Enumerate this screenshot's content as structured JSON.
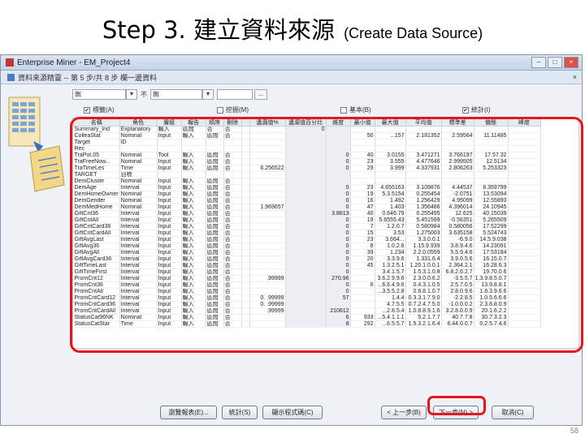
{
  "slide": {
    "title_main": "Step 3. 建立資料來源",
    "title_sub": "(Create Data Source)",
    "page_number": "58"
  },
  "window": {
    "title": "Enterprise Miner - EM_Project4",
    "dialog_title": "資料來源精靈 -- 第 5 步/共 8 步 欄一邊資料"
  },
  "filters": {
    "field1_value": "無",
    "label2": "不",
    "field2_value": "無",
    "field3_value": "",
    "browse_label": "..."
  },
  "checkboxes": [
    {
      "label": "標籤(A)",
      "checked": true
    },
    {
      "label": "挖掘(M)",
      "checked": false
    },
    {
      "label": "基本(B)",
      "checked": false
    },
    {
      "label": "統計(I)",
      "checked": true
    }
  ],
  "table": {
    "columns": [
      "名稱",
      "角色",
      "層級",
      "報告",
      "順序",
      "刪除",
      "",
      "遺漏值%",
      "遺漏值百分比",
      "維度",
      "最小值",
      "最大值",
      "平均值",
      "標準差",
      "偏態",
      "峰度"
    ],
    "rows": [
      [
        "Summary_Ind",
        "Explanatory",
        "輸入",
        "區間",
        "否",
        "否",
        "",
        "",
        "0",
        "",
        "",
        "",
        "",
        "",
        "",
        ""
      ],
      [
        "ColleaStat",
        "Nominal",
        "Input",
        "輸入",
        "區間",
        "否",
        "",
        "",
        "",
        "",
        "50",
        "...157",
        "2.181352",
        "2.59564",
        "11.11485"
      ],
      [
        "Target",
        "ID",
        "",
        "",
        "",
        "",
        "",
        "",
        "",
        "",
        "",
        "",
        "",
        "",
        "",
        ""
      ],
      [
        "Rec",
        "",
        "",
        "",
        "",
        "",
        "",
        "",
        "",
        "",
        "",
        "",
        "",
        "",
        "",
        ""
      ],
      [
        "TraPot.05",
        "Nominal",
        "Tool",
        "輸入",
        "區間",
        "否",
        "",
        "",
        "",
        "0",
        "40",
        "3.0155",
        "3.471271",
        "3.766197",
        "17.57.32"
      ],
      [
        "TraFreeNow...",
        "Nominal",
        "Input",
        "輸入",
        "區間",
        "否",
        "",
        "",
        "",
        "0",
        "23",
        "3.555",
        "4.477646",
        "2.999505",
        "12.5134"
      ],
      [
        "TraTimeLes",
        "Time",
        "Input",
        "輸入",
        "區間",
        "否",
        "",
        "6.256522",
        "",
        "0",
        "29",
        "3.999",
        "4.337931",
        "2.806263",
        "5.253323"
      ],
      [
        "TARGET",
        "目標",
        "",
        "",
        "",
        "",
        "",
        "",
        "",
        "",
        "",
        "",
        "",
        "",
        "",
        ""
      ],
      [
        "DemCluster",
        "Nominal",
        "Input",
        "輸入",
        "區間",
        "否",
        "",
        "",
        "",
        "",
        "",
        "",
        "",
        "",
        "",
        ""
      ],
      [
        "DemAge",
        "Interval",
        "Input",
        "輸入",
        "區間",
        "否",
        "",
        "",
        "",
        "0",
        "23",
        "4.655163",
        "3.109876",
        "4.44537",
        "8.359799"
      ],
      [
        "DemHomeOwner",
        "Nominal",
        "Input",
        "輸入",
        "區間",
        "否",
        "",
        "",
        "",
        "0",
        "19",
        "5.3.5154",
        "0.255454",
        "-2.0751",
        "13.53094"
      ],
      [
        "DemGender",
        "Nominal",
        "Input",
        "輸入",
        "區間",
        "否",
        "",
        "",
        "",
        "0",
        "16",
        "1.492",
        "1.256429",
        "4.95099",
        "12.55893"
      ],
      [
        "DemMedHome",
        "Nominal",
        "Input",
        "輸入",
        "區間",
        "否",
        "",
        "1.969657",
        "",
        "0",
        "47",
        "1.403",
        "1.356486",
        "4.396014",
        "24.10945"
      ],
      [
        "GiftCnt36",
        "Interval",
        "Input",
        "輸入",
        "區間",
        "否",
        "",
        "",
        "",
        "3.8613",
        "40",
        "0.646.79",
        "0.255495",
        "12.625",
        "40.15039"
      ],
      [
        "GiftCntAll",
        "Interval",
        "Input",
        "輸入",
        "區間",
        "否",
        "",
        "",
        "",
        "0",
        "19",
        "5.6555.43",
        "5.451599",
        "-0.56351",
        "5.265509"
      ],
      [
        "GiftCntCard36",
        "Interval",
        "Input",
        "輸入",
        "區間",
        "否",
        "",
        "",
        "",
        "0",
        "7",
        "1.2.0.7",
        "0.580984",
        "0.580056",
        "17.52299"
      ],
      [
        "GiftCntCardAll",
        "Interval",
        "Input",
        "輸入",
        "區間",
        "否",
        "",
        "",
        "",
        "0",
        "15",
        "3.53",
        "1.275003",
        "3.635158",
        "5.524743"
      ],
      [
        "GiftAvgLast",
        "Interval",
        "Input",
        "輸入",
        "區間",
        "否",
        "",
        "",
        "",
        "0",
        "23",
        "3.664...",
        "3.3.0.0.1",
        "-6.9.0",
        "14.5.9.038"
      ],
      [
        "GiftAvg36",
        "Interval",
        "Input",
        "輸入",
        "區間",
        "否",
        "",
        "",
        "",
        "0",
        "8",
        "1.0.2.6",
        "1.15.9.939",
        "3.8.9.4.6",
        "14.23091"
      ],
      [
        "GiftAvgAll",
        "Interval",
        "Input",
        "輸入",
        "區間",
        "否",
        "",
        "",
        "",
        "0",
        "39",
        "1.234",
        "2.2.0.0559",
        "5.5.9.4.6",
        "17.53184"
      ],
      [
        "GiftAvgCard36",
        "Interval",
        "Input",
        "輸入",
        "區間",
        "否",
        "",
        "",
        "",
        "0",
        "20",
        "3.3.9.6",
        "1.331.6.4",
        "3.9.0.5.6",
        "16.15.0.7"
      ],
      [
        "GiftTimeLast",
        "Interval",
        "Input",
        "輸入",
        "區間",
        "否",
        "",
        "",
        "",
        "0",
        "45",
        "1.3.2.5.1",
        "1.20.1.0.0.1",
        "2.364.2.1",
        "16.28.6.3"
      ],
      [
        "GiftTimeFirst",
        "Interval",
        "Input",
        "輸入",
        "區間",
        "否",
        "",
        "",
        "",
        "0",
        "",
        "3.4.1.5.7",
        "1.5.3.1.0.8",
        "6.8.2.6.2.7",
        "19.70.0.6"
      ],
      [
        "PromCnt12",
        "Interval",
        "Input",
        "輸入",
        "區間",
        "否",
        "",
        ".99999",
        "",
        "270.96",
        "",
        "3.6.2.9.9.6",
        "2.3.0.0.6.2",
        "-3.5.5.7",
        "1.3.9.8.5.0.7"
      ],
      [
        "PromCnt36",
        "Interval",
        "Input",
        "輸入",
        "區間",
        "否",
        "",
        "",
        "",
        "0",
        "6",
        "...6.6.4.9.6",
        "0.4.3.1.0.5",
        "2.5.7.0.5",
        "13.9.8.8.1"
      ],
      [
        "PromCntAll",
        "Interval",
        "Input",
        "輸入",
        "區間",
        "否",
        "",
        "",
        "",
        "0",
        "",
        "...3.5.5.2.8",
        "0.6.8.1.0.7",
        "2.8.0.9.6",
        "1.8.3.9.6.6"
      ],
      [
        "PromCntCard12",
        "Interval",
        "Input",
        "輸入",
        "區間",
        "否",
        "",
        "0. .99999",
        "",
        "57",
        "",
        "1.4.4",
        "0.3.3.1.7.9.0",
        "-2.2.8.5",
        "1.0.5.6.6.6"
      ],
      [
        "PromCntCard36",
        "Interval",
        "Input",
        "輸入",
        "區間",
        "否",
        "",
        "0. .99999",
        "",
        "",
        "",
        "4.7.5.5",
        "0.7.2.4.7.5.0",
        "-1.0.0.0.2",
        "2.3.8.8.0.9"
      ],
      [
        "PromCntCardAll",
        "Interval",
        "Input",
        "輸入",
        "區間",
        "否",
        "",
        ".99999",
        "",
        "210612",
        "",
        "...2.8.5.4",
        "1.0.8.8.9.1.6",
        "3.2.8.0.0.9",
        "20.1.6.2.2"
      ],
      [
        "StatusCat96NK",
        "Nominal",
        "Input",
        "輸入",
        "區間",
        "否",
        "",
        "",
        "",
        "6",
        "933",
        "...5.4.1.1.1",
        "5.2.1.7.7",
        "40.7.7.8",
        "30.7.3.2.3"
      ],
      [
        "StatusCatStar",
        "Time",
        "Input",
        "輸入",
        "區間",
        "否",
        "",
        "",
        "",
        "8",
        "292",
        "...6.5.5.7",
        "1.5.3.2.1.6.4",
        "6.44.0.0.7",
        "0.2.5.7.4.6"
      ]
    ]
  },
  "buttons": {
    "explore": "瀏覽報表(E)...",
    "compute": "統計(S)",
    "showcode": "顯示程式碼(C)",
    "back": "< 上一步(B)",
    "next": "下一步(N) >",
    "cancel": "取消(C)"
  },
  "colors": {
    "highlight": "#e8141c",
    "window_border": "#8a97aa",
    "selected_row": "#2f64c9"
  }
}
